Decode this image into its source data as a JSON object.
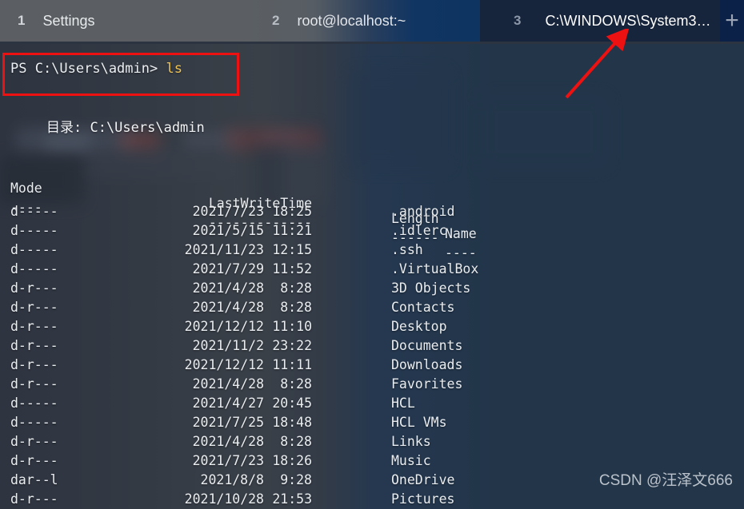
{
  "window": {
    "tabs": [
      {
        "index": "1",
        "title": "Settings",
        "active": false
      },
      {
        "index": "2",
        "title": "root@localhost:~",
        "active": false
      },
      {
        "index": "3",
        "title": "C:\\WINDOWS\\System3…",
        "active": true
      }
    ],
    "new_tab_icon": "plus-icon"
  },
  "terminal": {
    "prompt_prefix": "PS C:\\Users\\admin> ",
    "command": "ls",
    "directory_line": "目录: C:\\Users\\admin",
    "headers": {
      "mode": "Mode",
      "lastwritetime": "LastWriteTime",
      "length": "Length",
      "name": "Name"
    },
    "separators": {
      "mode": "----",
      "lastwritetime": "-------------",
      "length": "------",
      "name": "----"
    },
    "rows": [
      {
        "mode": "d-----",
        "date": "2021/7/23",
        "time": "18:25",
        "length": "",
        "name": ".android"
      },
      {
        "mode": "d-----",
        "date": "2021/5/15",
        "time": "11:21",
        "length": "",
        "name": ".idlerc"
      },
      {
        "mode": "d-----",
        "date": "2021/11/23",
        "time": "12:15",
        "length": "",
        "name": ".ssh"
      },
      {
        "mode": "d-----",
        "date": "2021/7/29",
        "time": "11:52",
        "length": "",
        "name": ".VirtualBox"
      },
      {
        "mode": "d-r---",
        "date": "2021/4/28",
        "time": "8:28",
        "length": "",
        "name": "3D Objects"
      },
      {
        "mode": "d-r---",
        "date": "2021/4/28",
        "time": "8:28",
        "length": "",
        "name": "Contacts"
      },
      {
        "mode": "d-r---",
        "date": "2021/12/12",
        "time": "11:10",
        "length": "",
        "name": "Desktop"
      },
      {
        "mode": "d-r---",
        "date": "2021/11/2",
        "time": "23:22",
        "length": "",
        "name": "Documents"
      },
      {
        "mode": "d-r---",
        "date": "2021/12/12",
        "time": "11:11",
        "length": "",
        "name": "Downloads"
      },
      {
        "mode": "d-r---",
        "date": "2021/4/28",
        "time": "8:28",
        "length": "",
        "name": "Favorites"
      },
      {
        "mode": "d-----",
        "date": "2021/4/27",
        "time": "20:45",
        "length": "",
        "name": "HCL"
      },
      {
        "mode": "d-----",
        "date": "2021/7/25",
        "time": "18:48",
        "length": "",
        "name": "HCL VMs"
      },
      {
        "mode": "d-r---",
        "date": "2021/4/28",
        "time": "8:28",
        "length": "",
        "name": "Links"
      },
      {
        "mode": "d-r---",
        "date": "2021/7/23",
        "time": "18:26",
        "length": "",
        "name": "Music"
      },
      {
        "mode": "dar--l",
        "date": "2021/8/8",
        "time": "9:28",
        "length": "",
        "name": "OneDrive"
      },
      {
        "mode": "d-r---",
        "date": "2021/10/28",
        "time": "21:53",
        "length": "",
        "name": "Pictures"
      }
    ]
  },
  "annotations": {
    "highlight_box_color": "#ee1111",
    "arrow_color": "#ee1111"
  },
  "watermark": {
    "text": "CSDN @汪泽文666"
  },
  "colors": {
    "terminal_text": "#e8eaed",
    "command_accent": "#f0c355",
    "active_tab_bg": "#16243c",
    "inactive_tab_bg": "#5b5f63",
    "new_tab_bg": "#0c2147"
  }
}
